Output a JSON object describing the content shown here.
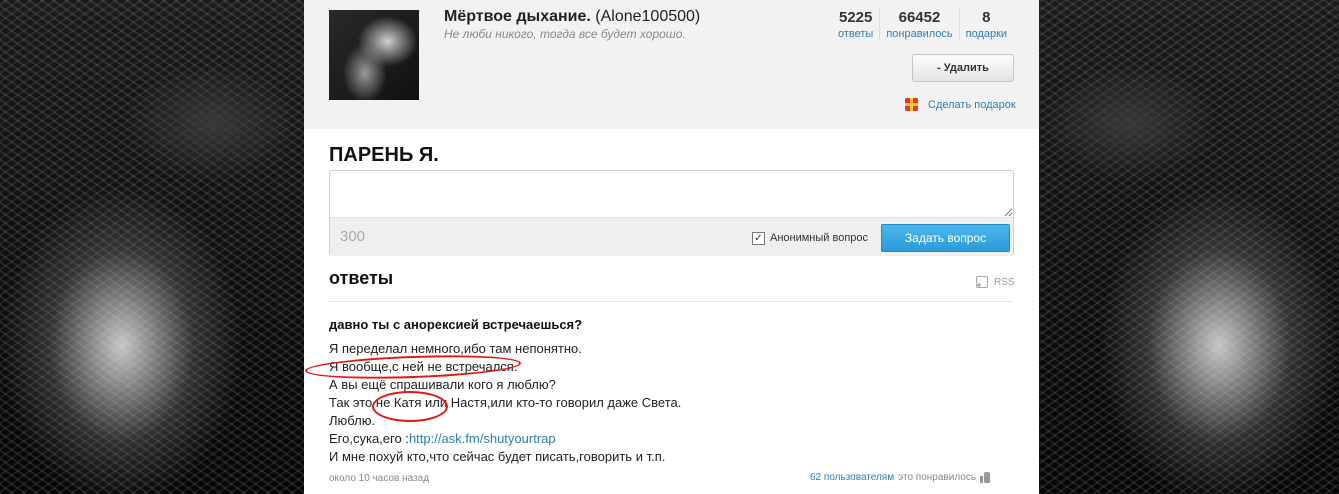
{
  "profile": {
    "display_name": "Мёртвое дыхание.",
    "username": "(Alone100500)",
    "status": "Не люби никого, тогда все будет хорошо.",
    "avatar_icon": "avatar-photo"
  },
  "stats": [
    {
      "value": "5225",
      "label": "ответы"
    },
    {
      "value": "66452",
      "label": "понравилось"
    },
    {
      "value": "8",
      "label": "подарки"
    }
  ],
  "actions": {
    "delete_label": "- Удалить",
    "gift_label": "Сделать подарок"
  },
  "page_title": "ПАРЕНЬ Я.",
  "ask_form": {
    "placeholder": "",
    "char_count": "300",
    "anonymous_label": "Анонимный вопрос",
    "anonymous_checked": true,
    "submit_label": "Задать вопрос"
  },
  "answers_section": {
    "heading": "ответы",
    "rss_label": "RSS"
  },
  "answer": {
    "question": "давно ты с анорексией встречаешься?",
    "lines": [
      "Я переделал немного,ибо там непонятно.",
      "Я вообще,с ней не встречался.",
      "А вы ещё спрашивали кого я люблю?",
      "Так это не Катя или Настя,или кто-то говорил даже Света.",
      "Люблю.",
      "Его,сука,его :",
      "И мне похуй кто,что сейчас будет писать,говорить и т.п."
    ],
    "link": "http://ask.fm/shutyourtrap",
    "timestamp": "около 10 часов назад",
    "likes_link": "62 пользователям",
    "likes_suffix": "это понравилось"
  },
  "colors": {
    "link": "#2f7fb3",
    "ask_button": "#2a9bd8",
    "annotation_circle": "#e01818",
    "header_bg": "#f2f2f2"
  }
}
